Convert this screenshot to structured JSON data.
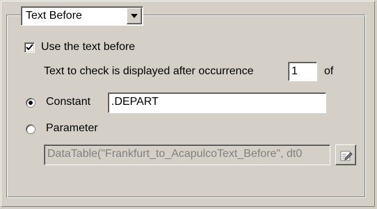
{
  "dropdown": {
    "selected": "Text Before"
  },
  "use_text_before": {
    "label": "Use the text before",
    "checked": true
  },
  "occurrence": {
    "label_before": "Text to check is displayed after occurrence",
    "value": "1",
    "label_after": "of"
  },
  "constant": {
    "label": "Constant",
    "selected": true,
    "value": ".DEPART"
  },
  "parameter": {
    "label": "Parameter",
    "selected": false,
    "value": "DataTable(\"Frankfurt_to_AcapulcoText_Before\", dt0"
  },
  "edit_button": {
    "icon": "edit-parameter-icon"
  }
}
